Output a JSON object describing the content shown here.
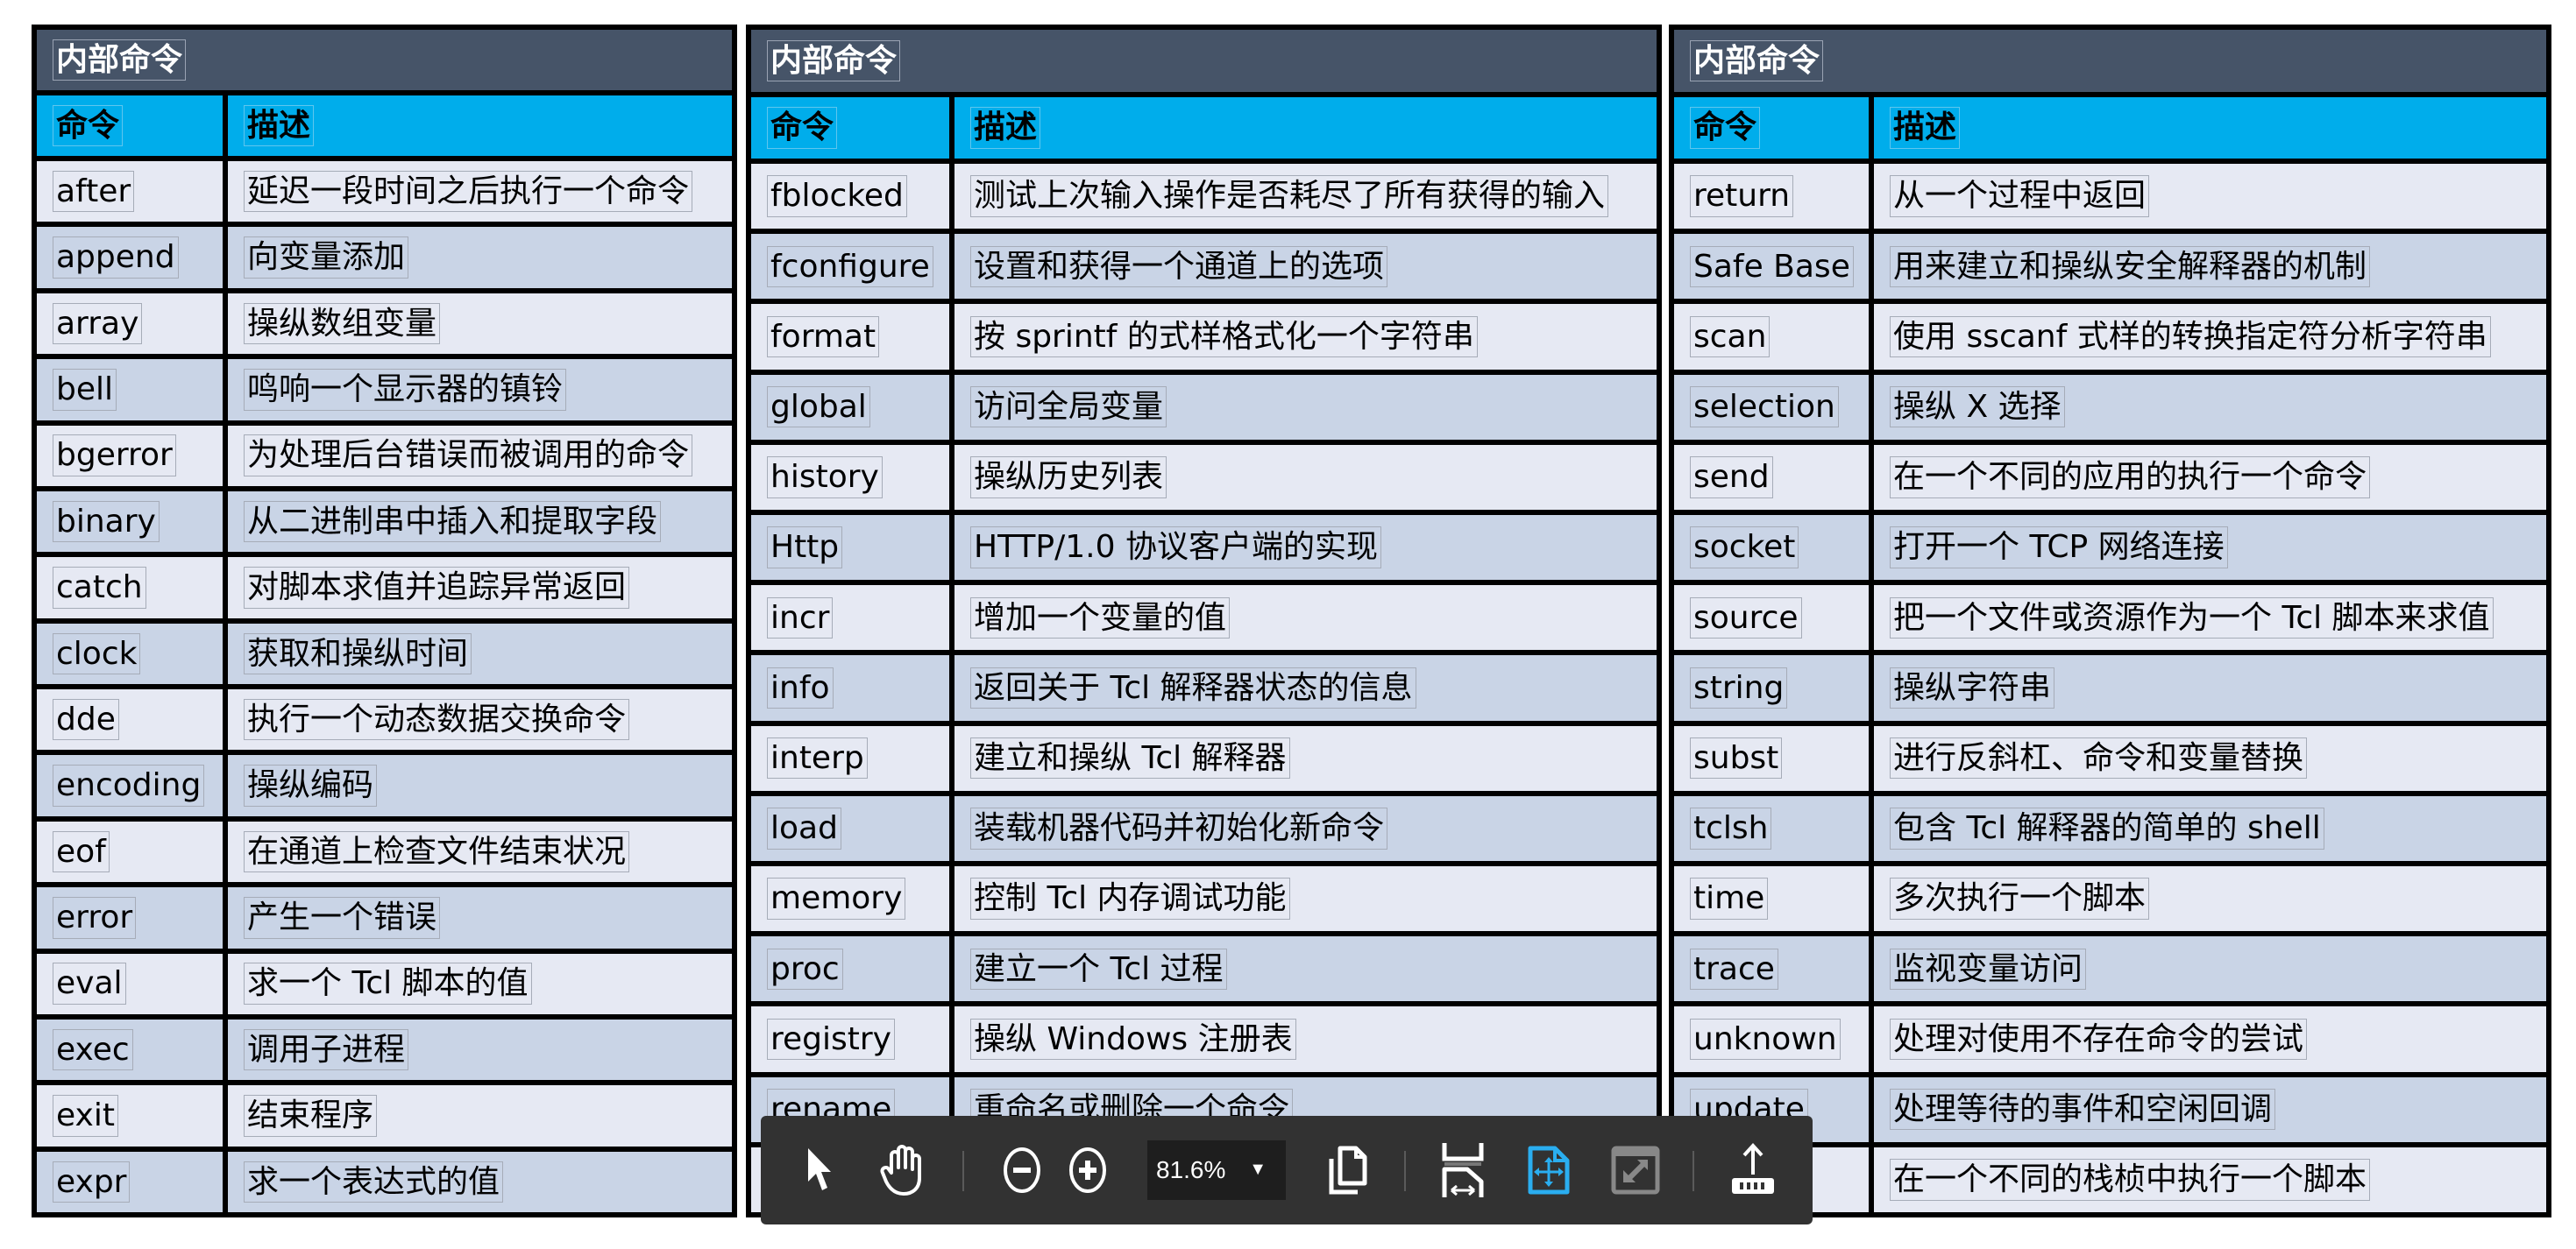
{
  "viewer": {
    "zoom_level": "81.6%",
    "toolbar": {
      "select_tool": "pointer-icon",
      "hand_tool": "hand-icon",
      "zoom_out": "zoom-out-icon",
      "zoom_in": "zoom-in-icon",
      "zoom_dropdown": "caret-down-icon",
      "page_view": "page-copy-icon",
      "fit_width": "fit-width-icon",
      "fit_page": "fit-page-icon",
      "fullscreen": "fullscreen-icon",
      "export": "upload-icon",
      "active_color": "#2aaef0"
    }
  },
  "colors": {
    "title_bg": "#465468",
    "header_bg": "#00adeb",
    "row_light": "#e6e9f3",
    "row_dark": "#c9d4e6"
  },
  "tables": [
    {
      "title": "内部命令",
      "headers": {
        "command": "命令",
        "description": "描述"
      },
      "rows": [
        {
          "command": "after",
          "description": "延迟一段时间之后执行一个命令"
        },
        {
          "command": "append",
          "description": "向变量添加"
        },
        {
          "command": "array",
          "description": "操纵数组变量"
        },
        {
          "command": "bell",
          "description": "鸣响一个显示器的镇铃"
        },
        {
          "command": "bgerror",
          "description": "为处理后台错误而被调用的命令"
        },
        {
          "command": "binary",
          "description": "从二进制串中插入和提取字段"
        },
        {
          "command": "catch",
          "description": "对脚本求值并追踪异常返回"
        },
        {
          "command": "clock",
          "description": "获取和操纵时间"
        },
        {
          "command": "dde",
          "description": "执行一个动态数据交换命令"
        },
        {
          "command": "encoding",
          "description": "操纵编码"
        },
        {
          "command": "eof",
          "description": "在通道上检查文件结束状况"
        },
        {
          "command": "error",
          "description": "产生一个错误"
        },
        {
          "command": "eval",
          "description": "求一个 Tcl 脚本的值"
        },
        {
          "command": "exec",
          "description": "调用子进程"
        },
        {
          "command": "exit",
          "description": "结束程序"
        },
        {
          "command": "expr",
          "description": "求一个表达式的值"
        }
      ]
    },
    {
      "title": "内部命令",
      "headers": {
        "command": "命令",
        "description": "描述"
      },
      "rows": [
        {
          "command": "fblocked",
          "description": "测试上次输入操作是否耗尽了所有获得的输入"
        },
        {
          "command": "fconfigure",
          "description": "设置和获得一个通道上的选项"
        },
        {
          "command": "format",
          "description": "按 sprintf 的式样格式化一个字符串"
        },
        {
          "command": "global",
          "description": "访问全局变量"
        },
        {
          "command": "history",
          "description": "操纵历史列表"
        },
        {
          "command": "Http",
          "description": "HTTP/1.0 协议客户端的实现"
        },
        {
          "command": "incr",
          "description": "增加一个变量的值"
        },
        {
          "command": "info",
          "description": "返回关于 Tcl 解释器状态的信息"
        },
        {
          "command": "interp",
          "description": "建立和操纵 Tcl 解释器"
        },
        {
          "command": "load",
          "description": "装载机器代码并初始化新命令"
        },
        {
          "command": "memory",
          "description": "控制 Tcl 内存调试功能"
        },
        {
          "command": "proc",
          "description": "建立一个 Tcl 过程"
        },
        {
          "command": "registry",
          "description": "操纵 Windows 注册表"
        },
        {
          "command": "rename",
          "description": "重命名或删除一个命令"
        },
        {
          "command": "",
          "description": ""
        }
      ]
    },
    {
      "title": "内部命令",
      "headers": {
        "command": "命令",
        "description": "描述"
      },
      "rows": [
        {
          "command": "return",
          "description": "从一个过程中返回"
        },
        {
          "command": "Safe Base",
          "description": "用来建立和操纵安全解释器的机制"
        },
        {
          "command": "scan",
          "description": "使用 sscanf 式样的转换指定符分析字符串"
        },
        {
          "command": "selection",
          "description": "操纵 X 选择"
        },
        {
          "command": "send",
          "description": "在一个不同的应用的执行一个命令"
        },
        {
          "command": "socket",
          "description": "打开一个 TCP 网络连接"
        },
        {
          "command": "source",
          "description": "把一个文件或资源作为一个 Tcl 脚本来求值"
        },
        {
          "command": "string",
          "description": "操纵字符串"
        },
        {
          "command": "subst",
          "description": "进行反斜杠、命令和变量替换"
        },
        {
          "command": "tclsh",
          "description": "包含 Tcl 解释器的简单的 shell"
        },
        {
          "command": "time",
          "description": "多次执行一个脚本"
        },
        {
          "command": "trace",
          "description": "监视变量访问"
        },
        {
          "command": "unknown",
          "description": "处理对使用不存在命令的尝试"
        },
        {
          "command": "update",
          "description": "处理等待的事件和空闲回调"
        },
        {
          "command": "",
          "description": "在一个不同的栈桢中执行一个脚本"
        }
      ]
    }
  ]
}
